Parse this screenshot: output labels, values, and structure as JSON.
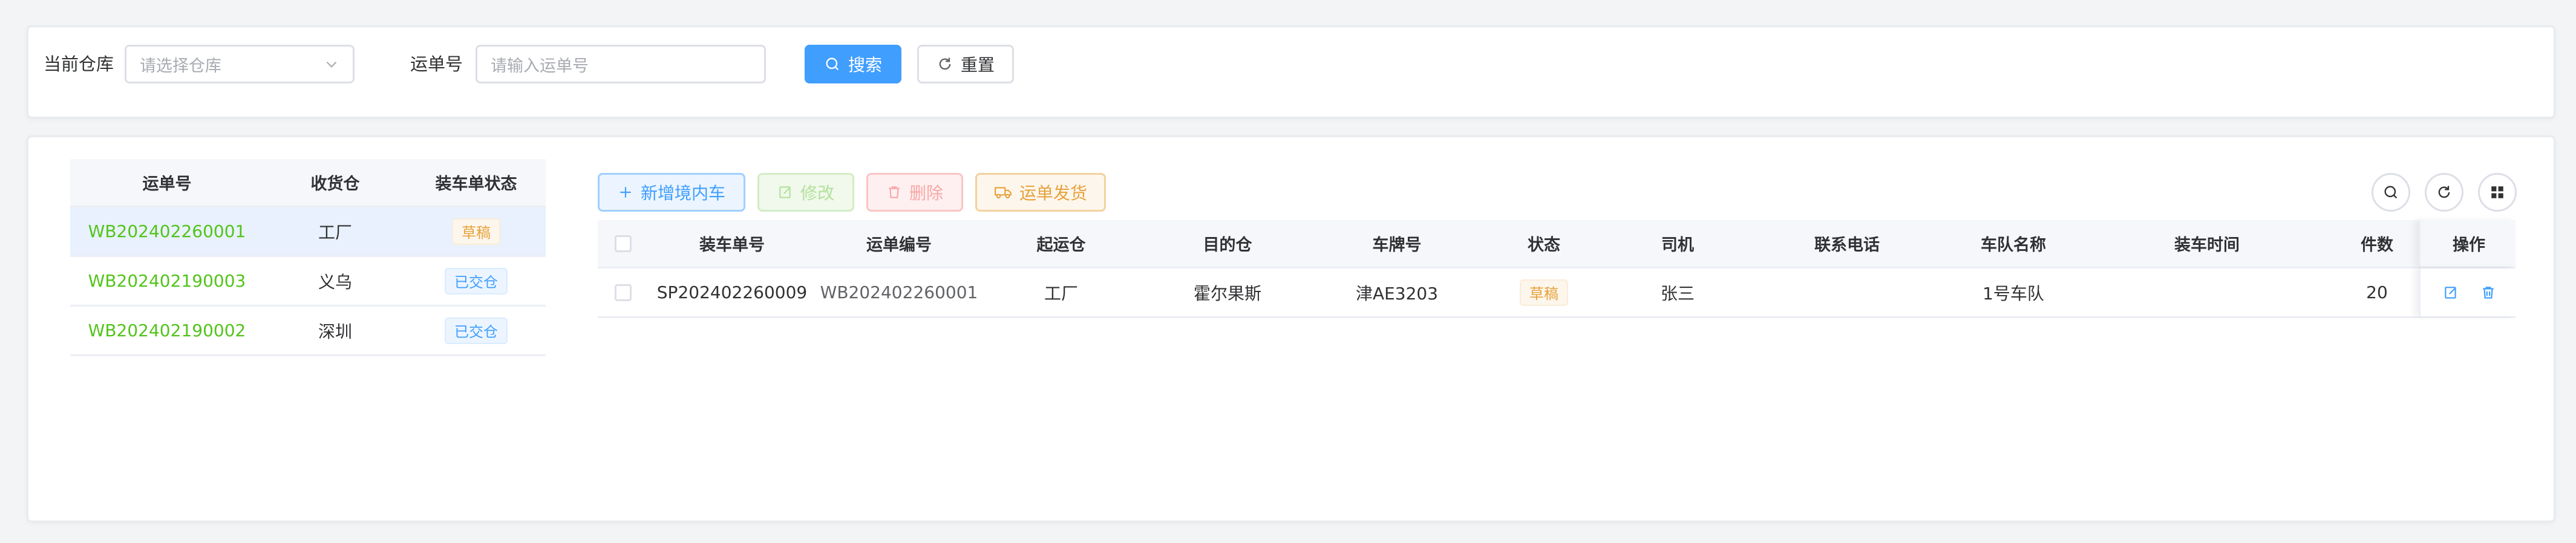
{
  "search": {
    "warehouse_label": "当前仓库",
    "warehouse_placeholder": "请选择仓库",
    "waybill_label": "运单号",
    "waybill_placeholder": "请输入运单号",
    "search_button": "搜索",
    "reset_button": "重置"
  },
  "waybills": {
    "headers": [
      "运单号",
      "收货仓",
      "装车单状态"
    ],
    "rows": [
      {
        "waybill_no": "WB202402260001",
        "warehouse": "工厂",
        "status": "草稿"
      },
      {
        "waybill_no": "WB202402190003",
        "warehouse": "义乌",
        "status": "已交仓"
      },
      {
        "waybill_no": "WB202402190002",
        "warehouse": "深圳",
        "status": "已交仓"
      }
    ]
  },
  "toolbar": {
    "add": "新增境内车",
    "edit": "修改",
    "delete": "删除",
    "ship": "运单发货"
  },
  "loading_table": {
    "headers": [
      "装车单号",
      "运单编号",
      "起运仓",
      "目的仓",
      "车牌号",
      "状态",
      "司机",
      "联系电话",
      "车队名称",
      "装车时间",
      "件数",
      "操作"
    ],
    "rows": [
      {
        "load_no": "SP202402260009",
        "waybill_no": "WB202402260001",
        "origin": "工厂",
        "destination": "霍尔果斯",
        "plate": "津AE3203",
        "status": "草稿",
        "driver": "张三",
        "phone": "",
        "fleet": "1号车队",
        "load_time": "",
        "count": "20"
      }
    ]
  },
  "colors": {
    "primary": "#409eff",
    "success": "#52c41a",
    "warning": "#e6a23c",
    "danger": "#f56c6c"
  }
}
